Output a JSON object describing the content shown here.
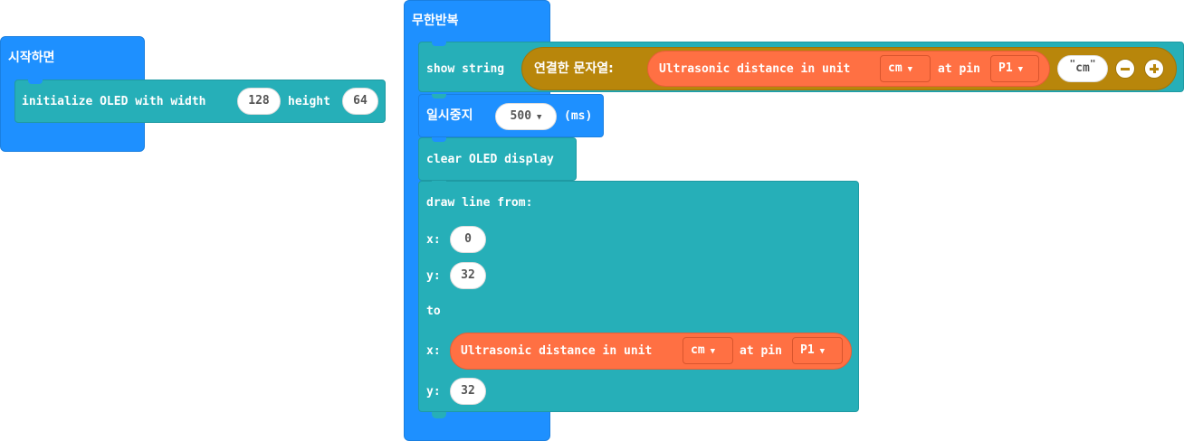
{
  "on_start": {
    "hat_label": "시작하면",
    "init_block": {
      "label_prefix": "initialize OLED with width",
      "width_value": "128",
      "label_height": "height",
      "height_value": "64"
    }
  },
  "forever": {
    "hat_label": "무한반복",
    "show_string": {
      "label": "show string",
      "join_label": "연결한 문자열:",
      "sensor_label": "Ultrasonic distance in unit",
      "unit_value": "cm",
      "at_pin_label": "at pin",
      "pin_value": "P1",
      "string_value": "cm",
      "quote_open": "\"",
      "quote_close": "\""
    },
    "pause": {
      "label": "일시중지",
      "ms_value": "500",
      "unit": "(ms)"
    },
    "clear": {
      "label": "clear OLED display"
    },
    "draw_line": {
      "label": "draw line from:",
      "x1_label": "x:",
      "x1_value": "0",
      "y1_label": "y:",
      "y1_value": "32",
      "to_label": "to",
      "x2_label": "x:",
      "x2_sensor_label": "Ultrasonic distance in unit",
      "x2_unit_value": "cm",
      "x2_at_pin_label": "at pin",
      "x2_pin_value": "P1",
      "y2_label": "y:",
      "y2_value": "32"
    }
  },
  "colors": {
    "hat_blue": "#1e90ff",
    "oled_teal": "#26afb8",
    "join_gold": "#b8860b",
    "sonar_orange": "#ff7043"
  }
}
